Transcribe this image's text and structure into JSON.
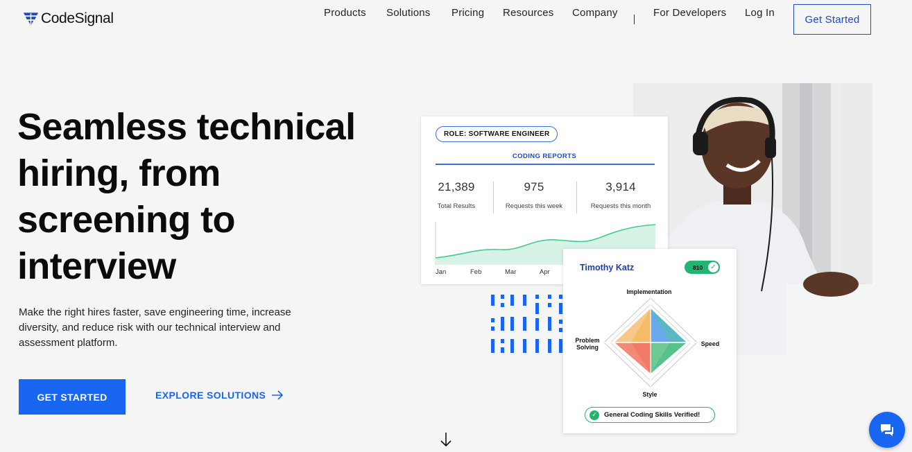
{
  "brand": {
    "name": "CodeSignal",
    "accent": "#1865f2",
    "dark_blue": "#1f48c7",
    "green": "#20b571"
  },
  "nav": {
    "items": [
      "Products",
      "Solutions",
      "Pricing",
      "Resources",
      "Company"
    ],
    "developers": "For Developers",
    "login": "Log In",
    "cta": "Get Started"
  },
  "hero": {
    "title": "Seamless technical hiring, from screening to interview",
    "subtitle": "Make the right hires faster, save engineering time, increase diversity, and reduce risk with our technical interview and assessment platform.",
    "primary_cta": "GET STARTED",
    "secondary_cta": "EXPLORE SOLUTIONS",
    "secondary_icon": "arrow-right-icon",
    "scroll_icon": "arrow-down-icon"
  },
  "report": {
    "role": "ROLE: SOFTWARE ENGINEER",
    "title": "CODING REPORTS",
    "stats": [
      {
        "value": "21,389",
        "label": "Total Results"
      },
      {
        "value": "975",
        "label": "Requests this week"
      },
      {
        "value": "3,914",
        "label": "Requests this month"
      }
    ],
    "months": [
      "Jan",
      "Feb",
      "Mar",
      "Apr"
    ]
  },
  "skill": {
    "name": "Timothy Katz",
    "score": "810",
    "axes": {
      "top": "Implementation",
      "right": "Speed",
      "bottom": "Style",
      "left_line1": "Problem",
      "left_line2": "Solving"
    },
    "verified": "General Coding Skills Verified!"
  },
  "chat": {
    "icon": "chat-bubble-icon"
  }
}
